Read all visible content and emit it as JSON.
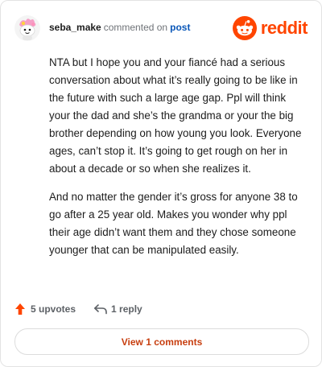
{
  "comment": {
    "username": "seba_make",
    "action_text": "commented on",
    "post_link": "post",
    "avatar_icon": "snoo-avatar-icon",
    "paragraphs": [
      "NTA but I hope you and your fiancé had a serious conversation about what it’s really going to be like in the future with such a large age gap. Ppl will think your the dad and she’s the grandma or your the big brother depending on how young you look. Everyone ages, can’t stop it. It’s going to get rough on her in about a decade or so when she realizes it.",
      "And no matter the gender it’s gross for anyone 38 to go after a 25 year old. Makes you wonder why ppl their age didn’t want them and they chose someone younger that can be manipulated easily."
    ]
  },
  "brand": {
    "name": "reddit",
    "logo_icon": "reddit-logo-icon",
    "color": "#ff4500"
  },
  "actions": {
    "upvotes_label": "5 upvotes",
    "upvote_icon": "upvote-arrow-icon",
    "reply_label": "1 reply",
    "reply_icon": "reply-arrow-icon"
  },
  "view_comments_label": "View 1 comments"
}
